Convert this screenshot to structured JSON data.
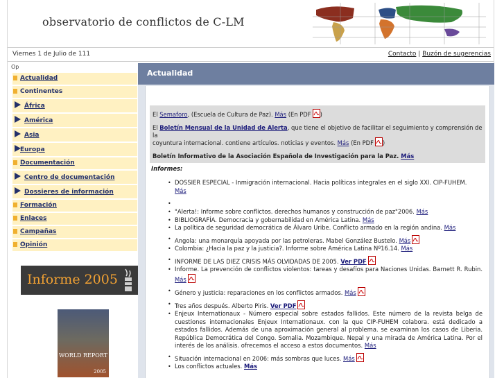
{
  "header": {
    "site_title": "observatorio de conflictos de C-LM"
  },
  "datebar": {
    "date": "Viernes 1 de Julio de 111",
    "contact_link": "Contacto",
    "separator": "|",
    "suggestions_link": "Buzón de sugerencias"
  },
  "sidebar": {
    "op_label": "Op",
    "nav": [
      {
        "label": "Actualidad",
        "type": "square",
        "underline": true
      },
      {
        "label": "Continentes",
        "type": "square",
        "underline": false
      },
      {
        "label": "África",
        "type": "triangle",
        "underline": true
      },
      {
        "label": "América",
        "type": "triangle",
        "underline": true
      },
      {
        "label": "Asia",
        "type": "triangle",
        "underline": true
      },
      {
        "label": "Europa",
        "type": "triangle",
        "underline": true
      },
      {
        "label": "Documentación",
        "type": "square",
        "underline": true
      },
      {
        "label": "Centro de documentación",
        "type": "triangle",
        "underline": true
      },
      {
        "label": "Dossieres de información",
        "type": "triangle",
        "underline": true
      },
      {
        "label": "Formación",
        "type": "square",
        "underline": true
      },
      {
        "label": "Enlaces",
        "type": "square",
        "underline": true
      },
      {
        "label": "Campañas",
        "type": "square",
        "underline": true
      },
      {
        "label": "Opinión",
        "type": "square",
        "underline": true
      }
    ],
    "banner_text": "Informe 2005",
    "book_title": "WORLD REPORT",
    "book_year": "2005"
  },
  "main": {
    "section_title": "Actualidad",
    "intro": {
      "l1_pre": "El ",
      "l1_link": "Semaforo",
      "l1_mid": ", (Escuela de Cultura de Paz). ",
      "l1_mas": "Más",
      "l1_post": " (En PDF",
      "l1_end": ")",
      "l2_pre": "El ",
      "l2_link": "Boletín Mensual de la Unidad de Alerta",
      "l2_post": ", que tiene el objetivo de facilitar el seguimiento y comprensión de la",
      "l3_pre": "coyuntura internacional. contiene artículos. noticias y eventos. ",
      "l3_mas": "Más",
      "l3_post": " (En PDF",
      "l3_end": ")",
      "l4_text": "Boletín Informativo de la Asociación Española de Investigación para la Paz. ",
      "l4_mas": "Más"
    },
    "informes_label": "Informes:",
    "items": [
      {
        "text": "DOSSIER ESPECIAL - Inmigración internacional. Hacia políticas integrales en el siglo XXI. CIP-FUHEM.",
        "link": "Más"
      },
      {
        "text": "",
        "link": ""
      },
      {
        "text": "\"Alerta!: Informe sobre conflictos. derechos humanos y construcción de paz\"2006. ",
        "link": "Más"
      },
      {
        "text": "BIBLIOGRAFÍA. Democracia y gobernabilidad en América Latina. ",
        "link": "Más"
      },
      {
        "text": "La política de seguridad democrática de Álvaro Uribe. Conflicto armado en la región andina. ",
        "link": "Más"
      },
      {
        "text": "Angola: una monarquía apoyada por las petroleras. Mabel González Bustelo. ",
        "link": "Más"
      },
      {
        "text": "Colombia: ¿Hacia la paz y la justicia?. Informe sobre América Latina Nº16.14. ",
        "link": "Más"
      },
      {
        "text": "INFORME DE LAS DIEZ CRISIS MÁS OLVIDADAS DE 2005. ",
        "link": "Ver PDF"
      },
      {
        "text": "Informe. La prevención de conflictos violentos: tareas y desafíos para Naciones Unidas. Barnett R. Rubin. ",
        "link": "Más"
      },
      {
        "text": "Género y justicia: reparaciones en los conflictos armados. ",
        "link": "Más"
      },
      {
        "text": "Tres años después. Alberto Piris. ",
        "link": "Ver PDF"
      },
      {
        "text": "Enjeux Internationaux - Número especial sobre estados fallidos. Este número de la revista belga de cuestiones internacionales Enjeux Internationaux. con la que CIP-FUHEM colabora. está dedicado a estados fallidos. Además de una aproximación general al problema. se examinan los casos de Liberia. República Democrática del Congo. Somalia. Mozambique. Nepal y una mirada de América Latina. Por el interés de los análisis. ofrecemos el acceso a estos documentos. ",
        "link": "Más"
      },
      {
        "text": "Situación internacional en 2006: más sombras que luces. ",
        "link": "Más"
      },
      {
        "text": "Los conflictos actuales. ",
        "link": "Más"
      }
    ]
  },
  "colors": {
    "nav_bg": "#fff1c2",
    "nav_marker": "#f0b030",
    "nav_text": "#23306a",
    "section_header": "#6e7fa0",
    "main_bg": "#dfe4ec",
    "intro_bg": "#dcdcdc"
  }
}
